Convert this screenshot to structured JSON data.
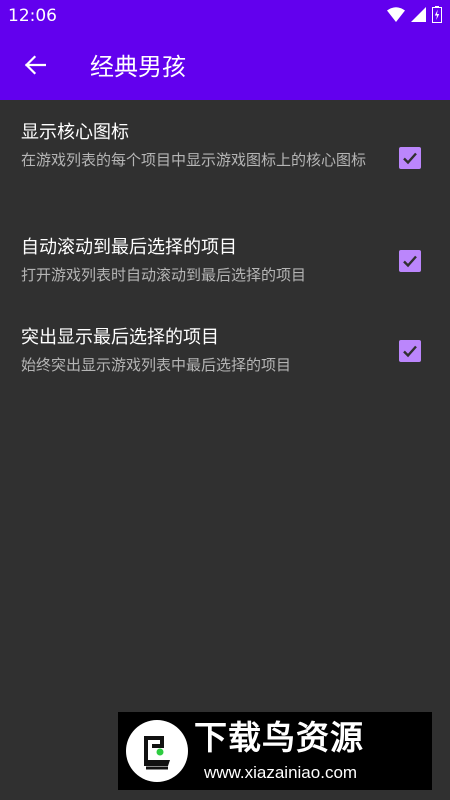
{
  "status_bar": {
    "time": "12:06",
    "icons": [
      "wifi-icon",
      "cell-signal-icon",
      "battery-icon"
    ]
  },
  "app_bar": {
    "title": "经典男孩",
    "back_icon": "arrow-back-icon"
  },
  "settings": [
    {
      "title": "显示核心图标",
      "summary": "在游戏列表的每个项目中显示游戏图标上的核心图标",
      "checked": true
    },
    {
      "title": "自动滚动到最后选择的项目",
      "summary": "打开游戏列表时自动滚动到最后选择的项目",
      "checked": true
    },
    {
      "title": "突出显示最后选择的项目",
      "summary": "始终突出显示游戏列表中最后选择的项目",
      "checked": true
    }
  ],
  "watermark": {
    "title": "下载鸟资源",
    "url": "www.xiazainiao.com"
  },
  "colors": {
    "primary": "#6200ee",
    "accent": "#bb86fc",
    "background": "#303030",
    "summary_text": "#b5b5b5"
  }
}
